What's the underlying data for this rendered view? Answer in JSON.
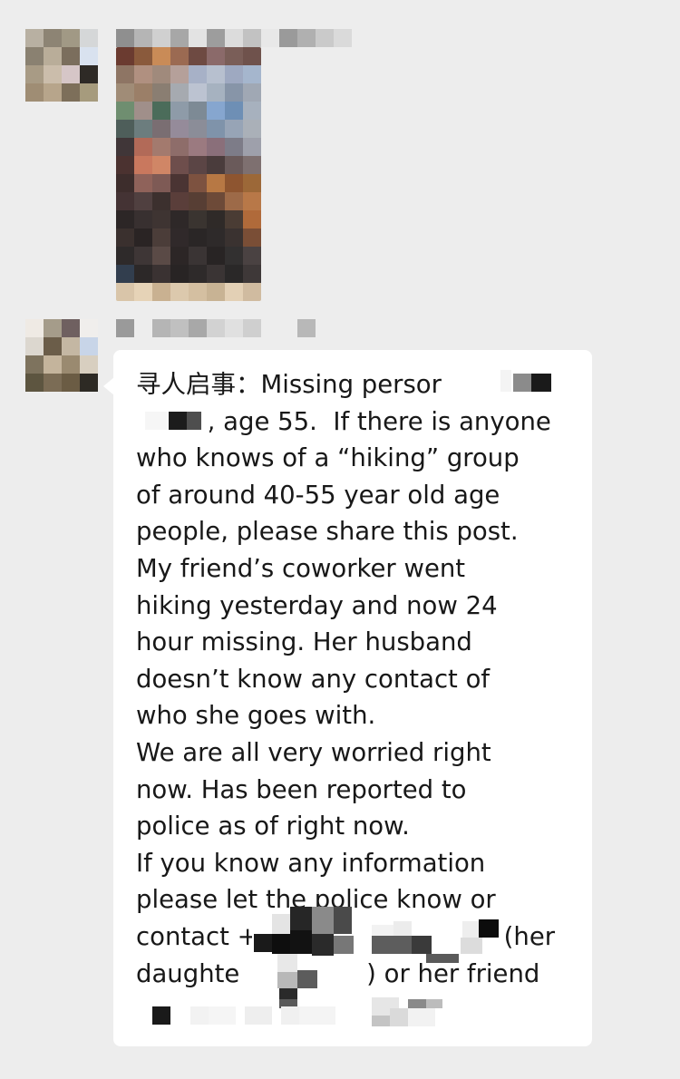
{
  "messages": [
    {
      "sender_name": "",
      "type": "image",
      "image_description": "pixelated-photo"
    },
    {
      "sender_name": "",
      "type": "text",
      "lines": [
        "寻人启事：Missing persor",
        "         , age 55.  If there is anyone",
        "who knows of a “hiking” group",
        "of around 40-55 year old age",
        "people, please share this post.",
        "My friend’s coworker went",
        "hiking yesterday and now 24",
        "hour missing. Her husband",
        "doesn’t know any contact of",
        "who she goes with.",
        "We are all very worried right",
        "now. Has been reported to",
        "police as of right now.",
        "If you know any information",
        "please let the police know or",
        "contact +                               (her",
        "daughte                ) or her friend"
      ]
    }
  ],
  "colors": {
    "background": "#ededed",
    "bubble": "#ffffff",
    "text": "#181818"
  }
}
